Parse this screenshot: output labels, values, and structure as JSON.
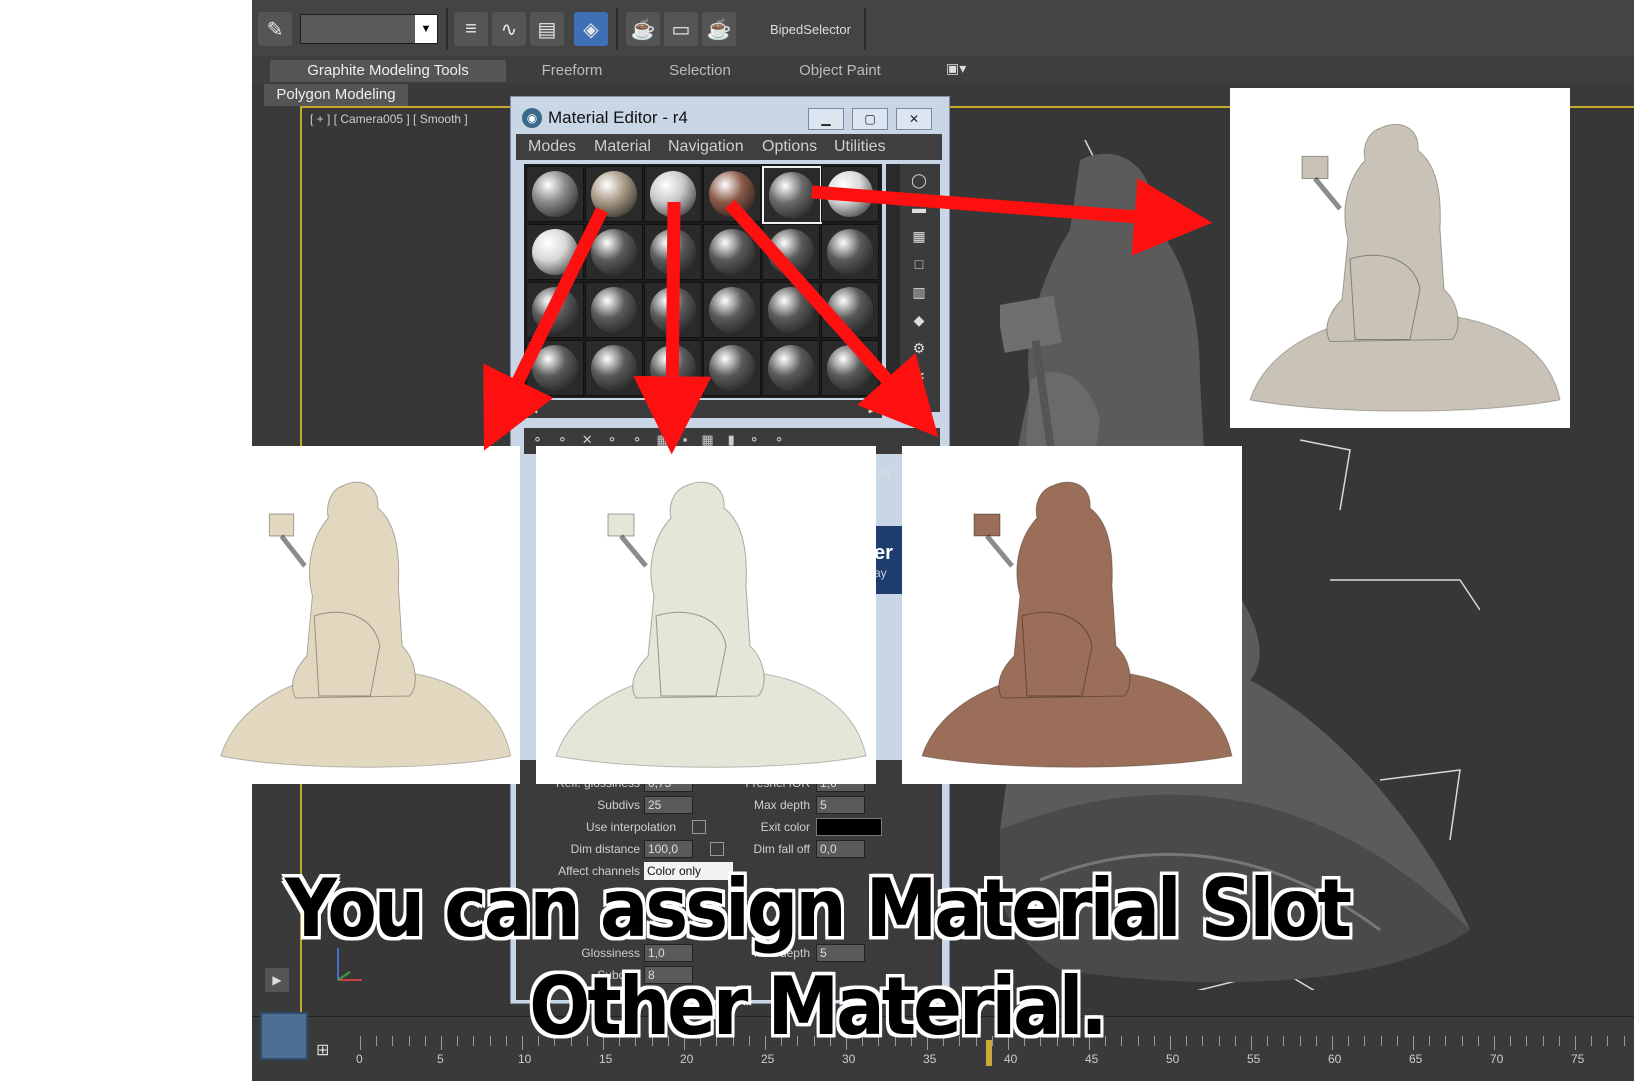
{
  "toolbar": {
    "biped_selector_label": "BipedSelector",
    "named_selection_value": "",
    "icons": [
      "abc-icon",
      "layer-icon",
      "curve-editor-icon",
      "schematic-icon",
      "material-editor-icon",
      "render-setup-icon",
      "render-frame-icon",
      "render-icon"
    ]
  },
  "ribbon": {
    "tabs": [
      "Graphite Modeling Tools",
      "Freeform",
      "Selection",
      "Object Paint"
    ],
    "active_tab": "Graphite Modeling Tools",
    "panel_tab": "Polygon Modeling"
  },
  "viewport": {
    "label": "[ + ] [ Camera005 ] [ Smooth ]"
  },
  "material_editor": {
    "title": "Material Editor - r4",
    "menu": [
      "Modes",
      "Material",
      "Navigation",
      "Options",
      "Utilities"
    ],
    "slot_colors": [
      "#8a8a8a",
      "#a89a85",
      "#c9c9c9",
      "#8a5a48",
      "#6a6a6a",
      "#d8d8d8"
    ],
    "partial_label_mtl": "Mtl",
    "partial_label_er": "er",
    "partial_label_ay": "ay",
    "params": {
      "refl_glossiness_label": "Refl. glossiness",
      "refl_glossiness_value": "0,75",
      "fresnel_ior_label": "Fresnel IOR",
      "fresnel_ior_value": "1,6",
      "subdivs_label": "Subdivs",
      "subdivs_value": "25",
      "max_depth_label": "Max depth",
      "max_depth_value": "5",
      "use_interpolation_label": "Use interpolation",
      "exit_color_label": "Exit color",
      "exit_color": "#000000",
      "dim_distance_label": "Dim distance",
      "dim_distance_value": "100,0",
      "dim_falloff_label": "Dim fall off",
      "dim_falloff_value": "0,0",
      "affect_channels_label": "Affect channels",
      "affect_channels_value": "Color only",
      "glossiness_label": "Glossiness",
      "glossiness_value": "1,0",
      "max_depth2_label": "Max depth",
      "max_depth2_value": "5",
      "subdivs2_label": "Subdivs",
      "subdivs2_value": "8"
    }
  },
  "timeline": {
    "ticks": [
      "0",
      "5",
      "10",
      "15",
      "20",
      "25",
      "30",
      "35",
      "40",
      "45",
      "50",
      "55",
      "60",
      "65",
      "70",
      "75"
    ]
  },
  "renders": {
    "top_right_tone": "#c8c3b6",
    "left_tone": "#e2d8bf",
    "middle_tone": "#e6e6d8",
    "right_tone": "#9a6e58"
  },
  "caption": {
    "line1": "You can assign Material Slot",
    "line2": "Other Material."
  },
  "colors": {
    "arrow": "#ff1010",
    "viewport_border": "#c7a92a",
    "active_button": "#3f6fb5"
  }
}
